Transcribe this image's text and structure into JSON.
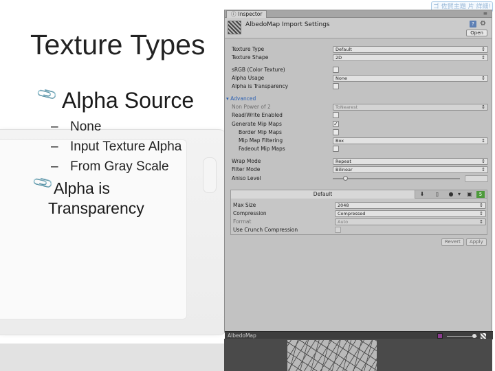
{
  "slide": {
    "title": "Texture Types",
    "bullets": [
      {
        "text": "Alpha Source",
        "sub_items": [
          "None",
          "Input Texture Alpha",
          "From Gray Scale"
        ]
      },
      {
        "text_line1": "Alpha is",
        "text_line2": "Transparency"
      }
    ],
    "bullet_icon": "paperclip-icon",
    "sub_marker": "–",
    "corner_label": "ゴ 佐賀主題 片 詳細!"
  },
  "inspector": {
    "tab_label": "Inspector",
    "tab_icon": "inspector-icon",
    "header_title": "AlbedoMap Import Settings",
    "open_button": "Open",
    "properties": [
      {
        "label": "Texture Type",
        "control": "dropdown",
        "value": "Default"
      },
      {
        "label": "Texture Shape",
        "control": "dropdown",
        "value": "2D"
      },
      {
        "label": "sRGB (Color Texture)",
        "control": "checkbox",
        "checked": false
      },
      {
        "label": "Alpha Usage",
        "control": "dropdown",
        "value": "None"
      },
      {
        "label": "Alpha is Transparency",
        "control": "checkbox",
        "checked": false
      }
    ],
    "advanced_label": "Advanced",
    "advanced_properties": [
      {
        "label": "Non Power of 2",
        "control": "dropdown",
        "value": "ToNearest",
        "disabled": true
      },
      {
        "label": "Read/Write Enabled",
        "control": "checkbox",
        "checked": false
      },
      {
        "label": "Generate Mip Maps",
        "control": "checkbox",
        "checked": true
      },
      {
        "label": "Border Mip Maps",
        "control": "checkbox",
        "checked": false,
        "indent": true
      },
      {
        "label": "Mip Map Filtering",
        "control": "dropdown",
        "value": "Box",
        "indent": true
      },
      {
        "label": "Fadeout Mip Maps",
        "control": "checkbox",
        "checked": false,
        "indent": true
      }
    ],
    "wrap_mode": {
      "label": "Wrap Mode",
      "value": "Repeat"
    },
    "filter_mode": {
      "label": "Filter Mode",
      "value": "Bilinear"
    },
    "aniso_level": {
      "label": "Aniso Level"
    },
    "platform": {
      "default_tab": "Default",
      "icons": [
        "download-icon",
        "mobile-icon",
        "apple-icon",
        "monitor-icon",
        "html5-icon"
      ],
      "properties": [
        {
          "label": "Max Size",
          "control": "dropdown",
          "value": "2048"
        },
        {
          "label": "Compression",
          "control": "dropdown",
          "value": "Compressed"
        },
        {
          "label": "Format",
          "control": "dropdown",
          "value": "Auto",
          "disabled": true
        },
        {
          "label": "Use Crunch Compression",
          "control": "checkbox",
          "checked": false
        }
      ]
    },
    "revert_button": "Revert",
    "apply_button": "Apply",
    "preview_title": "AlbedoMap"
  },
  "colors": {
    "inspector_bg": "#c2c2c2",
    "foldout_blue": "#2d61b3",
    "preview_bg": "#3e3e3e",
    "html5_badge": "#4d9a3b"
  }
}
